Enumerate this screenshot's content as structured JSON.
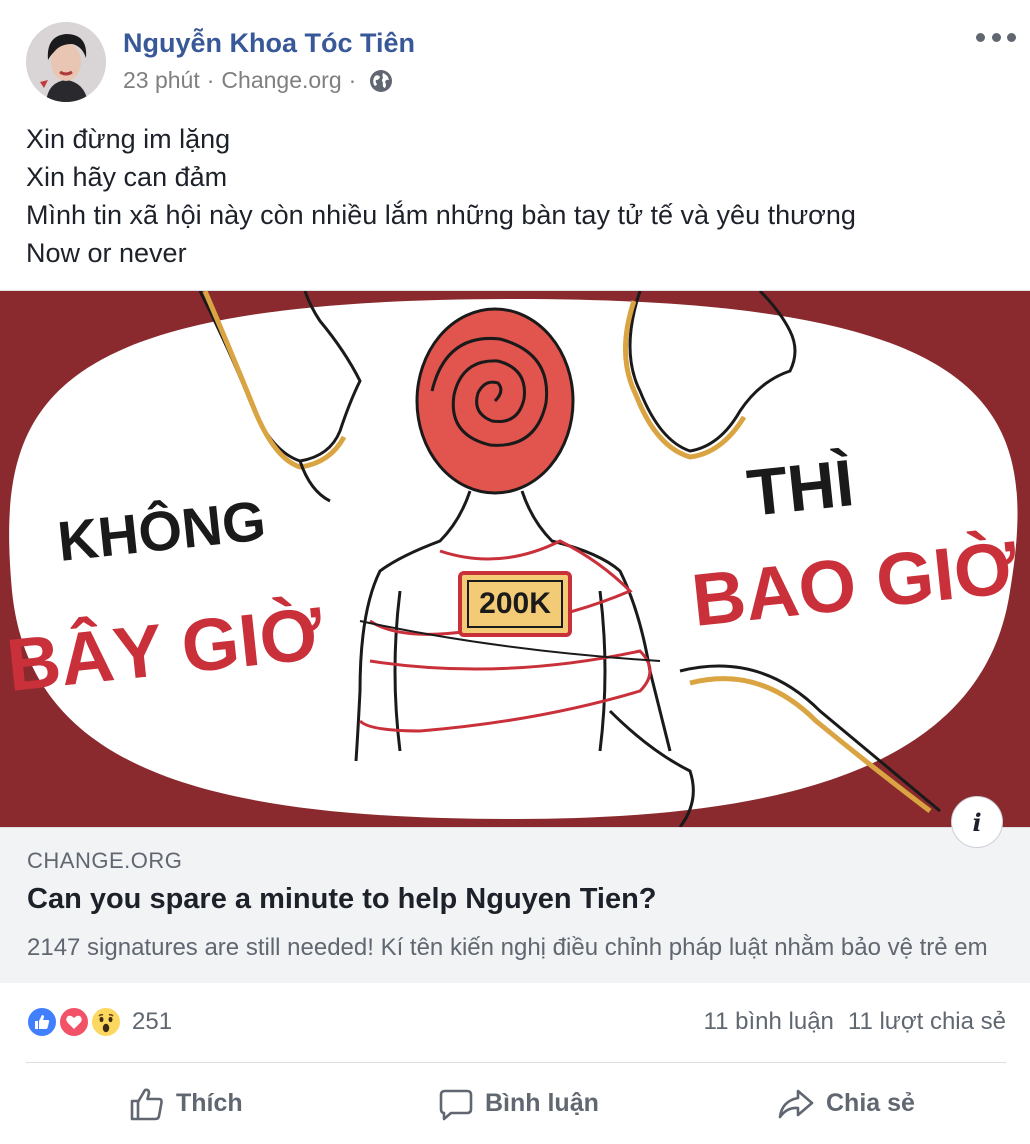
{
  "post": {
    "author": "Nguyễn Khoa Tóc Tiên",
    "time": "23 phút",
    "source": "Change.org",
    "separator": "·",
    "privacy_icon": "globe-icon",
    "more_icon": "more-options-icon",
    "body_lines": [
      "Xin đừng im lặng",
      "Xin hãy can đảm",
      "Mình tin xã hội này còn nhiều lắm những bàn tay tử tế và yêu thương",
      "Now or never"
    ]
  },
  "link_card": {
    "image": {
      "text_left_top": "KHÔNG",
      "text_left_bottom": "BÂY GIỜ",
      "text_right_top": "THÌ",
      "text_right_bottom": "BAO GIỜ",
      "badge": "200K"
    },
    "domain": "CHANGE.ORG",
    "title": "Can you spare a minute to help Nguyen Tien?",
    "description": "2147 signatures are still needed! Kí tên kiến nghị điều chỉnh pháp luật nhằm bảo vệ trẻ em",
    "info_label": "i"
  },
  "reactions": {
    "icons": [
      "like-reaction-icon",
      "love-reaction-icon",
      "wow-reaction-icon"
    ],
    "count": "251",
    "comments": "11 bình luận",
    "shares": "11 lượt chia sẻ"
  },
  "actions": {
    "like": "Thích",
    "comment": "Bình luận",
    "share": "Chia sẻ"
  },
  "colors": {
    "author_link": "#385898",
    "meta_text": "#7f7f7f",
    "secondary_text": "#606770",
    "card_bg": "#f2f3f5",
    "illustration_red": "#c9303a",
    "illustration_frame": "#8a2a2e",
    "illustration_gold": "#d9a441",
    "like_blue": "#4080ff",
    "love_red": "#f25268",
    "wow_yellow": "#fcd860"
  }
}
